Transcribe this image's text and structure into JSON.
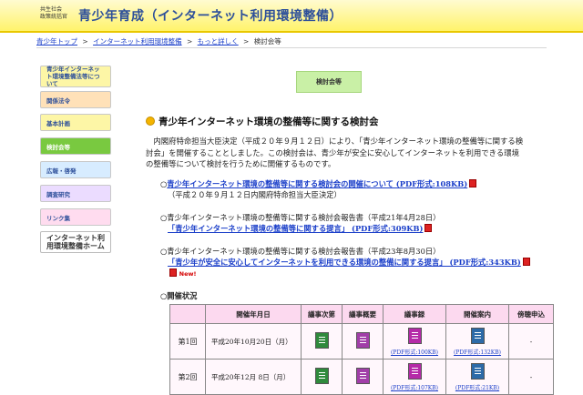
{
  "header": {
    "org_line1": "共生社会",
    "org_line2": "政策統括官",
    "title": "青少年育成（インターネット利用環境整備）"
  },
  "breadcrumb": {
    "items": [
      "青少年トップ",
      "インターネット利用環境整備",
      "もっと詳しく"
    ],
    "current": "検討会等",
    "separator": ">"
  },
  "sidebar": {
    "items": [
      {
        "label": "青少年インターネット環境整備法等について",
        "color": "#fdf6a6"
      },
      {
        "label": "関係法令",
        "color": "#ffe1b8"
      },
      {
        "label": "基本計画",
        "color": "#fdf6a6"
      },
      {
        "label": "検討会等",
        "color": "#79c940",
        "active": true
      },
      {
        "label": "広報・啓発",
        "color": "#d7ecff"
      },
      {
        "label": "調査研究",
        "color": "#ebdcff"
      },
      {
        "label": "リンク集",
        "color": "#ffdcef"
      }
    ],
    "home": "インターネット利用環境整備ホーム"
  },
  "page": {
    "badge": "検討会等",
    "heading": "青少年インターネット環境の整備等に関する検討会",
    "intro": "内閣府特命担当大臣決定（平成２０年９月１２日）により、「青少年インターネット環境の整備等に関する検討会」を開催することとしました。この検討会は、青少年が安全に安心してインターネットを利用できる環境の整備等について検討を行うために開催するものです。"
  },
  "documents": [
    {
      "bullet": "○",
      "link": "青少年インターネット環境の整備等に関する検討会の開催について (PDF形式:108KB)",
      "note": "（平成２０年９月１２日内閣府特命担当大臣決定）"
    },
    {
      "bullet": "○",
      "text": "青少年インターネット環境の整備等に関する検討会報告書（平成21年4月28日）",
      "link": "「青少年インターネット環境の整備等に関する提言」 (PDF形式:309KB)"
    },
    {
      "bullet": "○",
      "text": "青少年インターネット環境の整備等に関する検討会報告書（平成23年8月30日）",
      "link": "「青少年が安全に安心してインターネットを利用できる環境の整備に関する提言」 (PDF形式:343KB)",
      "new": "New!"
    }
  ],
  "status": {
    "label": "○開催状況",
    "columns": [
      "",
      "開催年月日",
      "議事次第",
      "議事概要",
      "議事録",
      "開催案内",
      "傍聴申込"
    ],
    "rows": [
      {
        "round": "第1回",
        "date": "平成20年10月20日（月）",
        "minutes_size": "(PDF形式:100KB)",
        "notice_size": "(PDF形式:132KB)",
        "apply": "-"
      },
      {
        "round": "第2回",
        "date": "平成20年12月 8日（月）",
        "minutes_size": "(PDF形式:107KB)",
        "notice_size": "(PDF形式:21KB)",
        "apply": "-"
      }
    ],
    "icon_colors": {
      "agenda": "#2f8a3c",
      "summary": "#a13ea8",
      "minutes": "#b52aa8",
      "notice": "#2c6aa8"
    }
  }
}
